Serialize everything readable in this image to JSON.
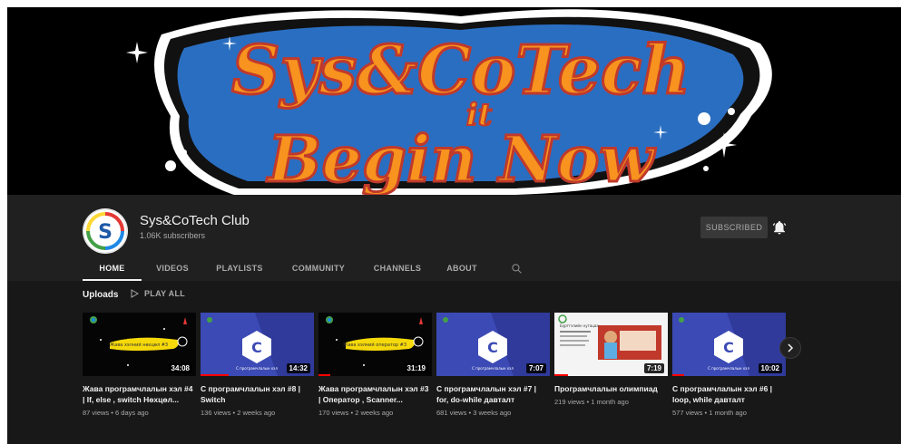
{
  "banner": {
    "line1": "Sys&CoTech",
    "line2": "it",
    "line3": "Begin Now"
  },
  "channel": {
    "name": "Sys&CoTech Club",
    "subscribers": "1.06K subscribers",
    "subscribe_label": "SUBSCRIBED"
  },
  "tabs": [
    {
      "label": "HOME"
    },
    {
      "label": "VIDEOS"
    },
    {
      "label": "PLAYLISTS"
    },
    {
      "label": "COMMUNITY"
    },
    {
      "label": "CHANNELS"
    },
    {
      "label": "ABOUT"
    }
  ],
  "shelf": {
    "title": "Uploads",
    "play_all": "PLAY ALL"
  },
  "videos": [
    {
      "title": "Жава програмчлалын хэл #4 | If, else , switch Нөхцөл...",
      "duration": "34:08",
      "views": "87 views",
      "age": "6 days ago",
      "thumb_text": "Жава хэлний нөхцөл #3",
      "watched": 0
    },
    {
      "title": "C програмчлалын хэл #8 | Switch",
      "duration": "14:32",
      "views": "136 views",
      "age": "2 weeks ago",
      "thumb_text": "С програмчлалын хэл",
      "watched": 0.25
    },
    {
      "title": "Жава програмчлалын хэл #3 | Оператор , Scanner...",
      "duration": "31:19",
      "views": "170 views",
      "age": "2 weeks ago",
      "thumb_text": "Жава хэлний оператор #3",
      "watched": 0.1
    },
    {
      "title": "C програмчлалын хэл #7 | for, do-while давталт",
      "duration": "7:07",
      "views": "681 views",
      "age": "3 weeks ago",
      "thumb_text": "С програмчлалын хэл",
      "watched": 0
    },
    {
      "title": "Програмчлалын олимпиад",
      "duration": "7:19",
      "views": "219 views",
      "age": "1 month ago",
      "thumb_text": "Бүртгэлийн хугацаа",
      "watched": 0.12
    },
    {
      "title": "C програмчлалын хэл #6 | loop, while давталт",
      "duration": "10:02",
      "views": "577 views",
      "age": "1 month ago",
      "thumb_text": "С програмчлалын хэл",
      "watched": 0.1
    }
  ],
  "meta_separator": "•",
  "colors": {
    "background": "#181818",
    "header": "#202020",
    "accent_orange": "#f7931e",
    "thumb_blue": "#3c4ab5",
    "progress_red": "#ff0000"
  }
}
